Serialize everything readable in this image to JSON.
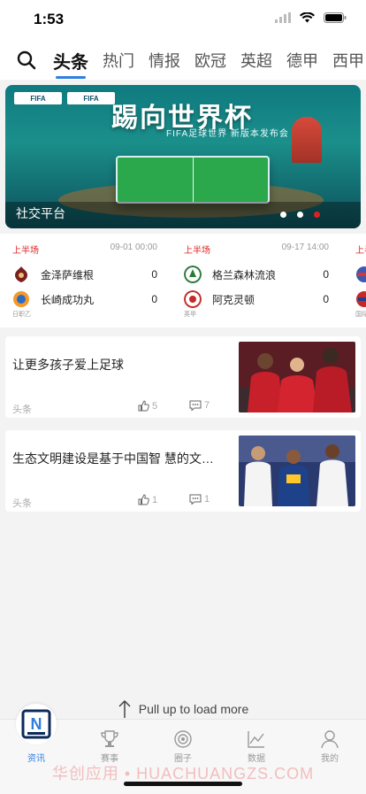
{
  "status": {
    "time": "1:53"
  },
  "nav": {
    "tabs": [
      "头条",
      "热门",
      "情报",
      "欧冠",
      "英超",
      "德甲",
      "西甲"
    ],
    "active": 0
  },
  "banner": {
    "title": "踢向世界杯",
    "subtitle": "FIFA足球世界 新版本发布会",
    "logo_left": "FIFA",
    "logo_right": "FIFA",
    "caption": "社交平台",
    "dot_count": 3,
    "active_dot": 2
  },
  "matches": [
    {
      "status": "上半场",
      "time": "09-01 00:00",
      "home": {
        "name": "金泽萨维根",
        "score": "0"
      },
      "away": {
        "name": "长崎成功丸",
        "score": "0"
      },
      "league": "日职乙"
    },
    {
      "status": "上半场",
      "time": "09-17 14:00",
      "home": {
        "name": "格兰森林流浪",
        "score": "0"
      },
      "away": {
        "name": "阿克灵顿",
        "score": "0"
      },
      "league": "英甲"
    },
    {
      "status": "上半场",
      "time": "",
      "home": {
        "name": "",
        "score": ""
      },
      "away": {
        "name": "",
        "score": ""
      },
      "league": "国际"
    }
  ],
  "articles": [
    {
      "title": "让更多孩子爱上足球",
      "source": "头条",
      "likes": "5",
      "comments": "7"
    },
    {
      "title": "生态文明建设是基于中国智 慧的文化成果",
      "source": "头条",
      "likes": "1",
      "comments": "1"
    }
  ],
  "pull_text": "Pull up to load more",
  "tabbar": {
    "items": [
      {
        "label": "资讯",
        "icon": "news-icon"
      },
      {
        "label": "赛事",
        "icon": "trophy-icon"
      },
      {
        "label": "圈子",
        "icon": "circle-icon"
      },
      {
        "label": "数据",
        "icon": "chart-icon"
      },
      {
        "label": "我的",
        "icon": "profile-icon"
      }
    ],
    "active": 0
  },
  "watermark": "华创应用 • HUACHUANGZS.COM",
  "colors": {
    "accent": "#2f7fe0",
    "live": "#e02020"
  }
}
